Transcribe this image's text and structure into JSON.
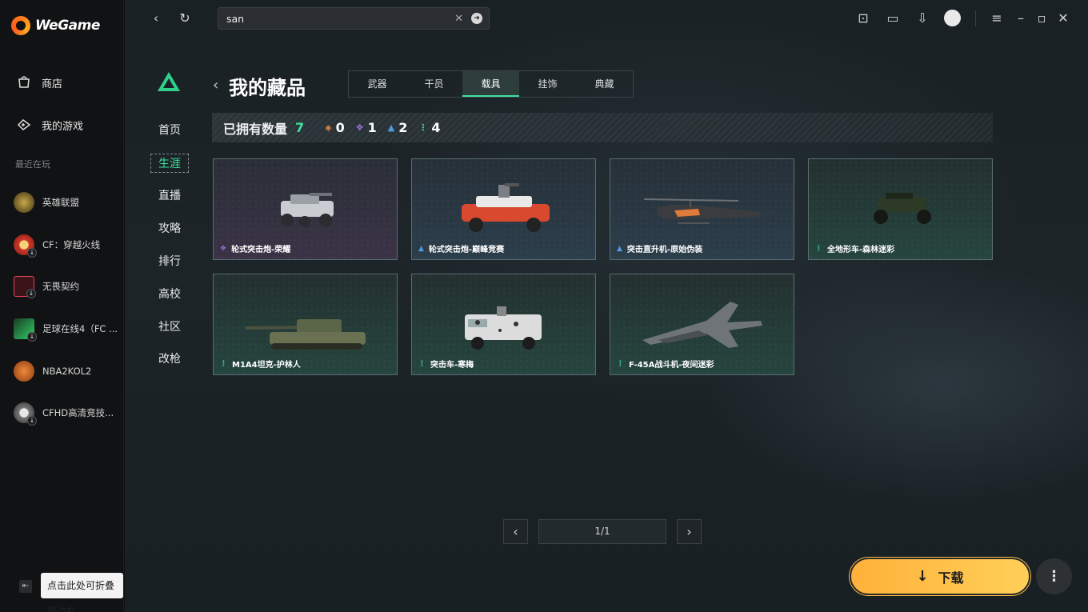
{
  "app": {
    "name": "WeGame"
  },
  "sidebar": {
    "items": [
      {
        "label": "商店",
        "icon": "store-icon"
      },
      {
        "label": "我的游戏",
        "icon": "gamepad-icon"
      }
    ],
    "recent_title": "最近在玩",
    "recent_games": [
      {
        "label": "英雄联盟",
        "icon": "lol-icon"
      },
      {
        "label": "CF：穿越火线",
        "icon": "cf-icon"
      },
      {
        "label": "无畏契约",
        "icon": "valorant-icon"
      },
      {
        "label": "足球在线4（FC ...",
        "icon": "fc-online-icon"
      },
      {
        "label": "NBA2KOL2",
        "icon": "nba2k-icon"
      },
      {
        "label": "CFHD高清竞技...",
        "icon": "cfhd-icon"
      }
    ],
    "collapse_tip": "点击此处可折叠侧边栏"
  },
  "search": {
    "value": "san"
  },
  "game_nav": {
    "items": [
      "首页",
      "生涯",
      "直播",
      "攻略",
      "排行",
      "高校",
      "社区",
      "改枪"
    ],
    "active": "生涯"
  },
  "page": {
    "title": "我的藏品",
    "tabs": [
      "武器",
      "干员",
      "载具",
      "挂饰",
      "典藏"
    ],
    "active_tab": "载具"
  },
  "stats": {
    "label": "已拥有数量",
    "total": "7",
    "rarities": [
      {
        "icon": "orange-diamond-icon",
        "color": "#e58a3c",
        "count": "0"
      },
      {
        "icon": "purple-diamond-icon",
        "color": "#9b6be0",
        "count": "1"
      },
      {
        "icon": "blue-tri-icon",
        "color": "#4d9be0",
        "count": "2"
      },
      {
        "icon": "green-dots-icon",
        "color": "#3fd0a0",
        "count": "4"
      }
    ]
  },
  "items": [
    {
      "name": "轮式突击炮-荣耀",
      "rarity": "purple",
      "vehicle": "armored-car"
    },
    {
      "name": "轮式突击炮-巅峰竞赛",
      "rarity": "blue",
      "vehicle": "armored-car-red"
    },
    {
      "name": "突击直升机-原始伪装",
      "rarity": "blue",
      "vehicle": "helicopter"
    },
    {
      "name": "全地形车-森林迷彩",
      "rarity": "green",
      "vehicle": "atv"
    },
    {
      "name": "M1A4坦克-护林人",
      "rarity": "green",
      "vehicle": "tank"
    },
    {
      "name": "突击车-寒梅",
      "rarity": "green",
      "vehicle": "armored-van"
    },
    {
      "name": "F-45A战斗机-夜间迷彩",
      "rarity": "green",
      "vehicle": "fighter-jet"
    }
  ],
  "pagination": {
    "page": "1/1"
  },
  "download": {
    "label": "下载"
  },
  "colors": {
    "accent": "#3fe0a0",
    "download": "#ffc14a"
  }
}
